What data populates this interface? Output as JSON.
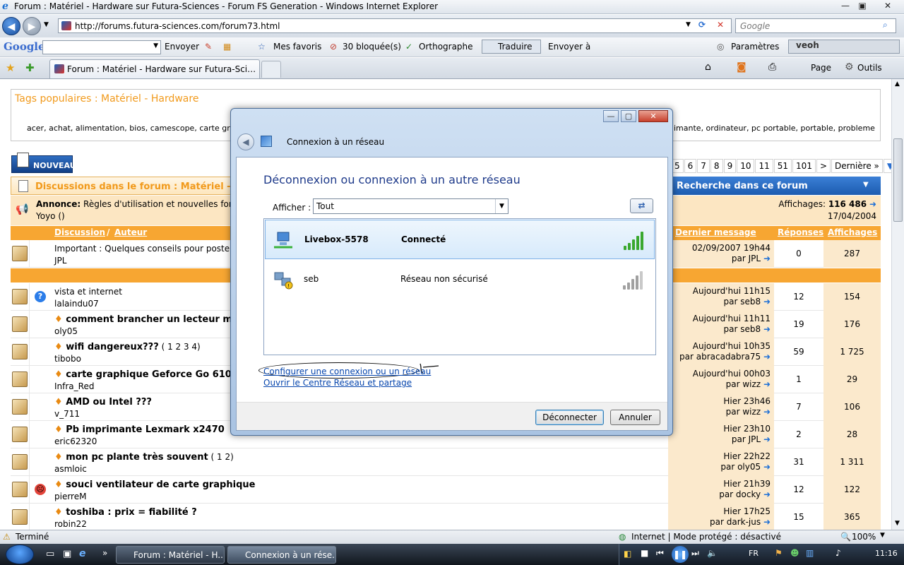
{
  "window": {
    "title": "Forum : Matériel - Hardware sur Futura-Sciences - Forum FS Generation - Windows Internet Explorer",
    "minimize": "—",
    "maximize": "▣",
    "close": "✕"
  },
  "address": {
    "url": "http://forums.futura-sciences.com/forum73.html",
    "search_placeholder": "Google"
  },
  "google_toolbar": {
    "logo": "Google",
    "envoyer": "Envoyer",
    "favoris": "Mes favoris",
    "bloquee": "30 bloquée(s)",
    "orthographe": "Orthographe",
    "traduire": "Traduire",
    "envoyer_a": "Envoyer à",
    "parametres": "Paramètres",
    "veoh": "veoh"
  },
  "tabs": {
    "active": "Forum : Matériel - Hardware sur Futura-Sciences ...",
    "page": "Page",
    "outils": "Outils"
  },
  "forum": {
    "tags_title": "Tags populaires : Matériel - Hardware",
    "tags_left": "acer, achat, alimentation, bios, camescope, carte graphiq",
    "tags_right": "imante, ordinateur, pc portable, portable, probleme",
    "nouveau": "NOUVEAU",
    "pager": [
      "6",
      "7",
      "8",
      "9",
      "10",
      "11",
      "51",
      "101",
      ">",
      "Dernière »"
    ],
    "pager_first": "5",
    "disc_title": "Discussions dans le forum : Matériel - Hardwa",
    "search_forum": "Recherche dans ce forum",
    "annonce_label": "Annonce:",
    "annonce_text": "Règles d'utilisation et nouvelles fonct",
    "annonce_author": "Yoyo ()",
    "annonce_views_label": "Affichages:",
    "annonce_views": "116 486",
    "annonce_date": "17/04/2004",
    "col_discussion": "Discussion",
    "col_auteur": "Auteur",
    "col_last": "Dernier message",
    "col_rep": "Réponses",
    "col_aff": "Affichages",
    "important_title": "Important : Quelques conseils pour poster",
    "important_author": "JPL",
    "important_last1": "02/09/2007 19h44",
    "important_last2": "par JPL",
    "important_rep": "0",
    "important_aff": "287",
    "threads": [
      {
        "title": "vista et internet",
        "author": "lalaindu07",
        "l1": "Aujourd'hui 11h15",
        "l2": "par seb8",
        "rep": "12",
        "aff": "154",
        "bold": false,
        "pages": ""
      },
      {
        "title": "comment brancher un lecteur multic",
        "author": "oly05",
        "l1": "Aujourd'hui 11h11",
        "l2": "par seb8",
        "rep": "19",
        "aff": "176",
        "bold": true,
        "pages": ""
      },
      {
        "title": "wifi dangereux???",
        "author": "tibobo",
        "l1": "Aujourd'hui 10h35",
        "l2": "par abracadabra75",
        "rep": "59",
        "aff": "1 725",
        "bold": true,
        "pages": " ( 1 2 3 4)"
      },
      {
        "title": "carte graphique Geforce Go 6100",
        "author": "Infra_Red",
        "l1": "Aujourd'hui 00h03",
        "l2": "par wizz",
        "rep": "1",
        "aff": "29",
        "bold": true,
        "pages": ""
      },
      {
        "title": "AMD ou Intel ???",
        "author": "v_711",
        "l1": "Hier 23h46",
        "l2": "par wizz",
        "rep": "7",
        "aff": "106",
        "bold": true,
        "pages": ""
      },
      {
        "title": "Pb imprimante Lexmark x2470",
        "author": "eric62320",
        "l1": "Hier 23h10",
        "l2": "par JPL",
        "rep": "2",
        "aff": "28",
        "bold": true,
        "pages": ""
      },
      {
        "title": "mon pc plante très souvent",
        "author": "asmloic",
        "l1": "Hier 22h22",
        "l2": "par oly05",
        "rep": "31",
        "aff": "1 311",
        "bold": true,
        "pages": " ( 1 2)"
      },
      {
        "title": "souci ventilateur de carte graphique",
        "author": "pierreM",
        "l1": "Hier 21h39",
        "l2": "par docky",
        "rep": "12",
        "aff": "122",
        "bold": true,
        "pages": ""
      },
      {
        "title": "toshiba : prix = fiabilité ?",
        "author": "robin22",
        "l1": "Hier 17h25",
        "l2": "par dark-jus",
        "rep": "15",
        "aff": "365",
        "bold": true,
        "pages": ""
      }
    ]
  },
  "dialog": {
    "title": "Connexion à un réseau",
    "heading": "Déconnexion ou connexion à un autre réseau",
    "show_label": "Afficher :",
    "show_value": "Tout",
    "networks": [
      {
        "name": "Livebox-5578",
        "status": "Connecté",
        "selected": true
      },
      {
        "name": "seb",
        "status": "Réseau non sécurisé",
        "selected": false
      }
    ],
    "link_setup": "Configurer une connexion ou un réseau",
    "link_center": "Ouvrir le Centre Réseau et partage",
    "btn_disconnect": "Déconnecter",
    "btn_cancel": "Annuler"
  },
  "status": {
    "left": "Terminé",
    "zone": "Internet | Mode protégé : désactivé",
    "zoom": "100%"
  },
  "taskbar": {
    "task1": "Forum : Matériel - H...",
    "task2": "Connexion à un rése...",
    "lang": "FR",
    "clock": "11:16"
  },
  "colors": {
    "accent_orange": "#f7a632",
    "link_blue": "#0645ad",
    "dialog_heading": "#1e3a8a"
  }
}
